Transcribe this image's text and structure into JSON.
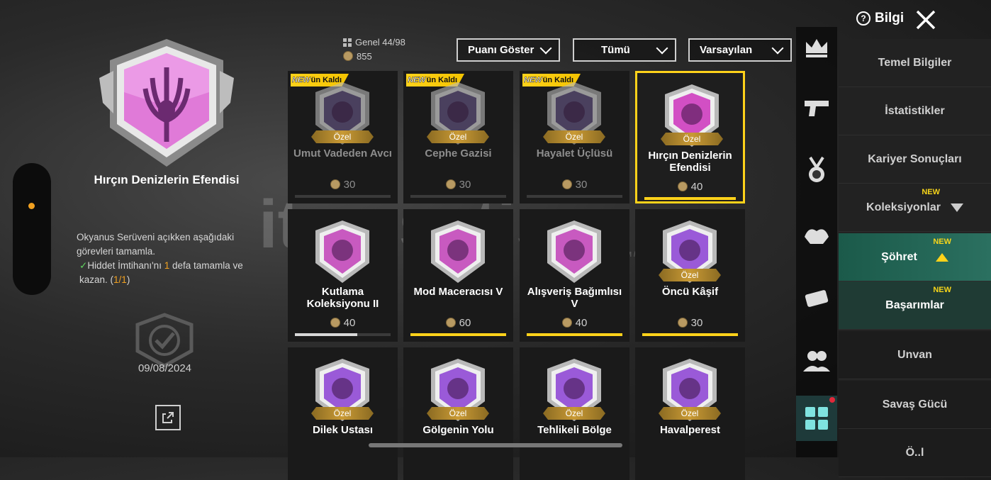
{
  "info_label": "Bilgi",
  "selected": {
    "title": "Hırçın Denizlerin Efendisi",
    "desc_line1": "Okyanus Serüveni açıkken aşağıdaki görevleri tamamla.",
    "desc_task": "Hiddet İmtihanı'nı ",
    "desc_count": "1",
    "desc_task2": " defa tamamla ve kazan. (",
    "desc_progress": "1/1",
    "desc_end": ")",
    "date": "09/08/2024"
  },
  "stats": {
    "genel": "Genel  44/98",
    "coins": "855"
  },
  "filters": [
    {
      "label": "Puanı Göster"
    },
    {
      "label": "Tümü"
    },
    {
      "label": "Varsayılan"
    }
  ],
  "cards": [
    {
      "tag_new": "NEW",
      "tag_text": "ün Kaldı",
      "special": "Özel",
      "name": "Umut Vadeden Avcı",
      "points": "30",
      "progress": 0,
      "dim": true,
      "color": "#6a5a8c"
    },
    {
      "tag_new": "NEW",
      "tag_text": "ün Kaldı",
      "special": "Özel",
      "name": "Cephe Gazisi",
      "points": "30",
      "progress": 0,
      "dim": true,
      "color": "#6a5a8c"
    },
    {
      "tag_new": "NEW",
      "tag_text": "ün Kaldı",
      "special": "Özel",
      "name": "Hayalet Üçlüsü",
      "points": "30",
      "progress": 0,
      "dim": true,
      "color": "#6a5a8c"
    },
    {
      "tag_new": "",
      "tag_text": "",
      "special": "Özel",
      "name": "Hırçın Denizlerin Efendisi",
      "points": "40",
      "progress": 1,
      "dim": false,
      "selected": true,
      "color": "#d24fc4"
    },
    {
      "tag_new": "",
      "tag_text": "",
      "special": "",
      "name": "Kutlama Koleksiyonu II",
      "points": "40",
      "progress": 0.65,
      "dim": false,
      "color": "#c85ac0",
      "bar_color": "#d8d8d8"
    },
    {
      "tag_new": "",
      "tag_text": "",
      "special": "",
      "name": "Mod Maceracısı V",
      "points": "60",
      "progress": 1,
      "dim": false,
      "color": "#c85ac0"
    },
    {
      "tag_new": "",
      "tag_text": "",
      "special": "",
      "name": "Alışveriş Bağımlısı V",
      "points": "40",
      "progress": 1,
      "dim": false,
      "color": "#c85ac0"
    },
    {
      "tag_new": "",
      "tag_text": "",
      "special": "Özel",
      "name": "Öncü Kâşif",
      "points": "30",
      "progress": 1,
      "dim": false,
      "color": "#9a5ad8"
    },
    {
      "tag_new": "",
      "tag_text": "",
      "special": "Özel",
      "name": "Dilek Ustası",
      "points": "",
      "progress": 0,
      "dim": false,
      "color": "#9a5ad8"
    },
    {
      "tag_new": "",
      "tag_text": "",
      "special": "Özel",
      "name": "Gölgenin Yolu",
      "points": "",
      "progress": 0,
      "dim": false,
      "color": "#9a5ad8"
    },
    {
      "tag_new": "",
      "tag_text": "",
      "special": "Özel",
      "name": "Tehlikeli Bölge",
      "points": "",
      "progress": 0,
      "dim": false,
      "color": "#9a5ad8"
    },
    {
      "tag_new": "",
      "tag_text": "",
      "special": "Özel",
      "name": "Havalperest",
      "points": "",
      "progress": 0,
      "dim": false,
      "color": "#9a5ad8"
    }
  ],
  "menu": [
    {
      "label": "Temel Bilgiler"
    },
    {
      "label": "İstatistikler"
    },
    {
      "label": "Kariyer Sonuçları"
    },
    {
      "label": "Koleksiyonlar",
      "new": "NEW"
    },
    {
      "label": "Şöhret",
      "new": "NEW"
    },
    {
      "label": "Başarımlar",
      "new": "NEW"
    },
    {
      "label": "Unvan"
    },
    {
      "label": "Savaş Gücü"
    },
    {
      "label": "Ö..l"
    }
  ],
  "rail_icons": [
    "crown-icon",
    "pistol-icon",
    "medal-icon",
    "muscle-icon",
    "vehicle-icon",
    "friends-icon",
    "grid-icon"
  ],
  "watermark": "itemsatis",
  "watermark_sub": "SKIN / ITEM / EPIN .com"
}
